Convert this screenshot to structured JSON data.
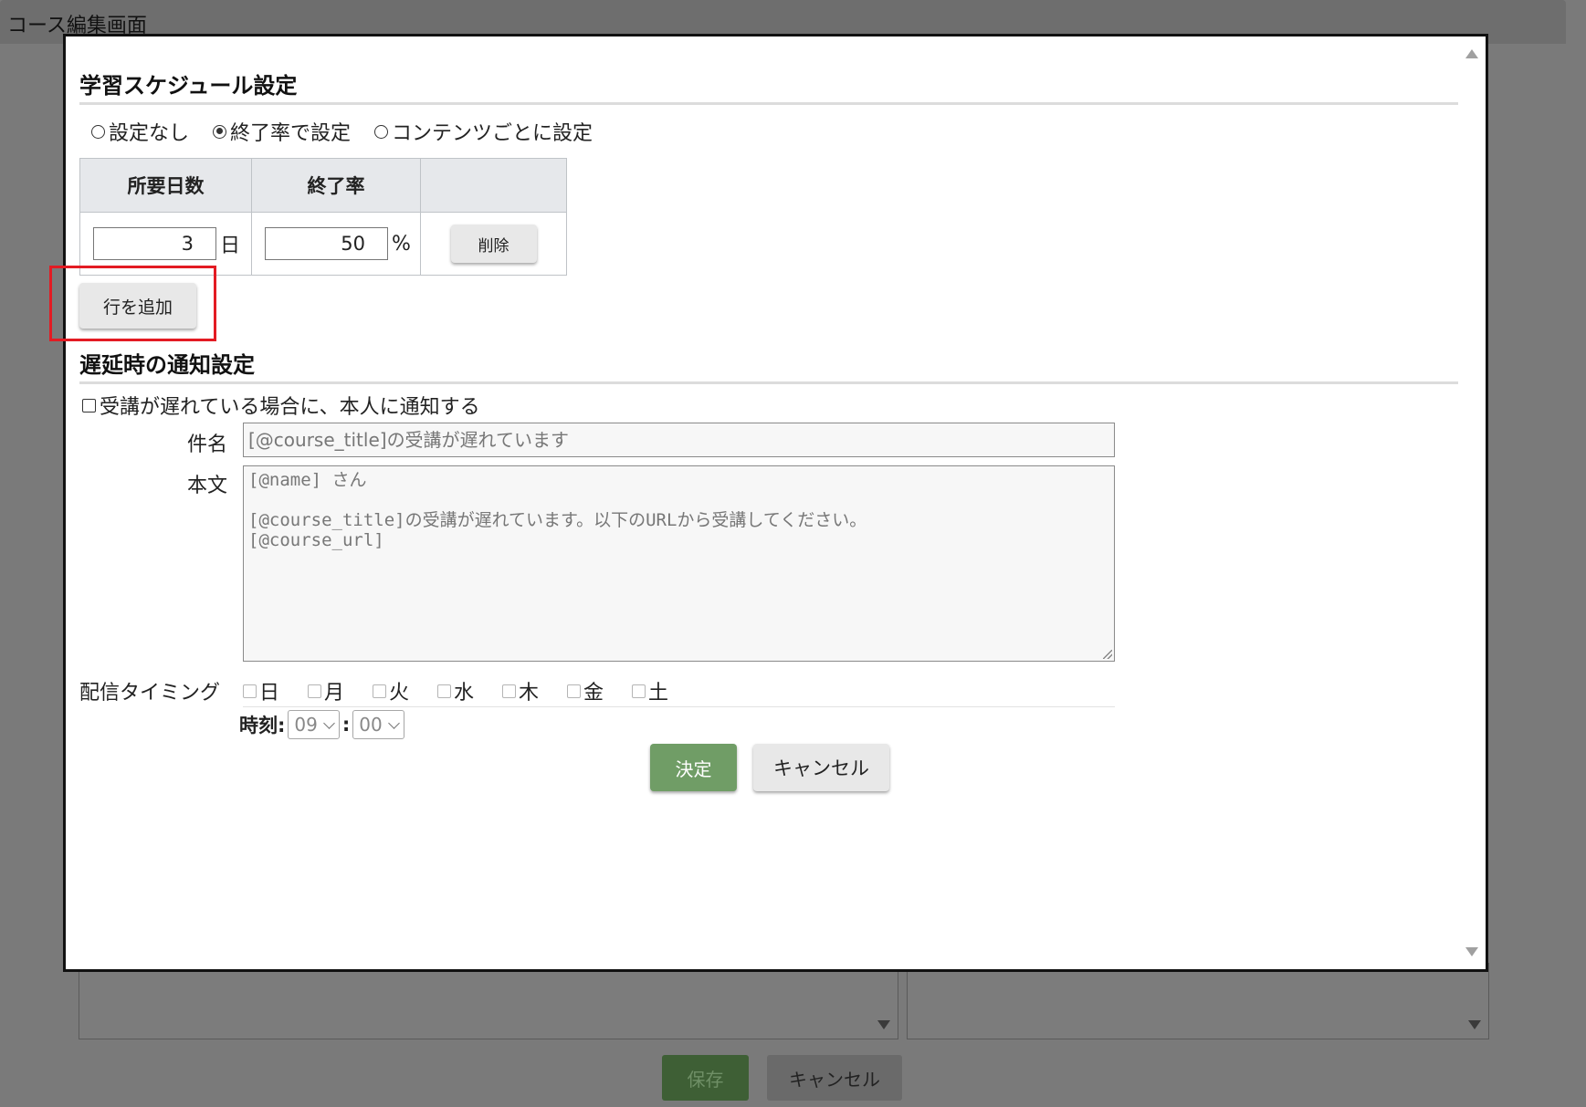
{
  "page": {
    "title": "コース編集画面"
  },
  "background": {
    "save_label": "保存",
    "cancel_label": "キャンセル"
  },
  "schedule": {
    "title": "学習スケジュール設定",
    "options": [
      {
        "label": "設定なし",
        "checked": false
      },
      {
        "label": "終了率で設定",
        "checked": true
      },
      {
        "label": "コンテンツごとに設定",
        "checked": false
      }
    ],
    "columns": [
      "所要日数",
      "終了率",
      ""
    ],
    "rows": [
      {
        "days": "3",
        "days_unit": "日",
        "rate": "50",
        "rate_unit": "%",
        "delete_label": "削除"
      }
    ],
    "add_row_label": "行を追加"
  },
  "notification": {
    "title": "遅延時の通知設定",
    "notify_label": "受講が遅れている場合に、本人に通知する",
    "subject_label": "件名",
    "subject_placeholder": "[@course_title]の受講が遅れています",
    "body_label": "本文",
    "body_placeholder": "[@name] さん\n\n[@course_title]の受講が遅れています。以下のURLから受講してください。\n[@course_url]",
    "timing_label": "配信タイミング",
    "days": [
      "日",
      "月",
      "火",
      "水",
      "木",
      "金",
      "土"
    ],
    "time_label": "時刻:",
    "hour": "09",
    "time_sep": ":",
    "minute": "00"
  },
  "actions": {
    "ok_label": "決定",
    "cancel_label": "キャンセル"
  },
  "colors": {
    "ok_button": "#709d66",
    "highlight": "#e31b23"
  }
}
